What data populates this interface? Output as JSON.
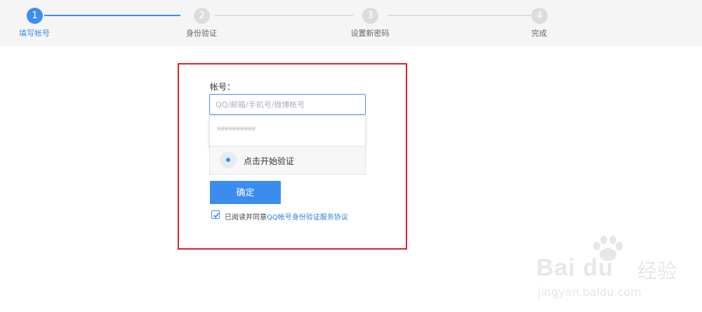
{
  "steps": [
    {
      "number": "1",
      "label": "填写帐号",
      "active": true
    },
    {
      "number": "2",
      "label": "身份验证",
      "active": false
    },
    {
      "number": "3",
      "label": "设置新密码",
      "active": false
    },
    {
      "number": "4",
      "label": "完成",
      "active": false
    }
  ],
  "form": {
    "account_label": "帐号：",
    "account_placeholder": "QQ/邮箱/手机号/微博帐号",
    "account_value": "",
    "suggestion_blurred": "**********",
    "verify_text": "点击开始验证",
    "confirm_label": "确定",
    "agree_prefix": "已阅读并同意",
    "agree_link": "QQ帐号身份验证服务协议",
    "agree_checked": true
  },
  "colors": {
    "accent": "#3d8ef0",
    "highlight_border": "#e2202a",
    "inactive_step": "#dcdcdc"
  },
  "watermark": {
    "brand": "Bai du",
    "brand_cn": "经验",
    "url": "jingyan.baidu.com"
  }
}
